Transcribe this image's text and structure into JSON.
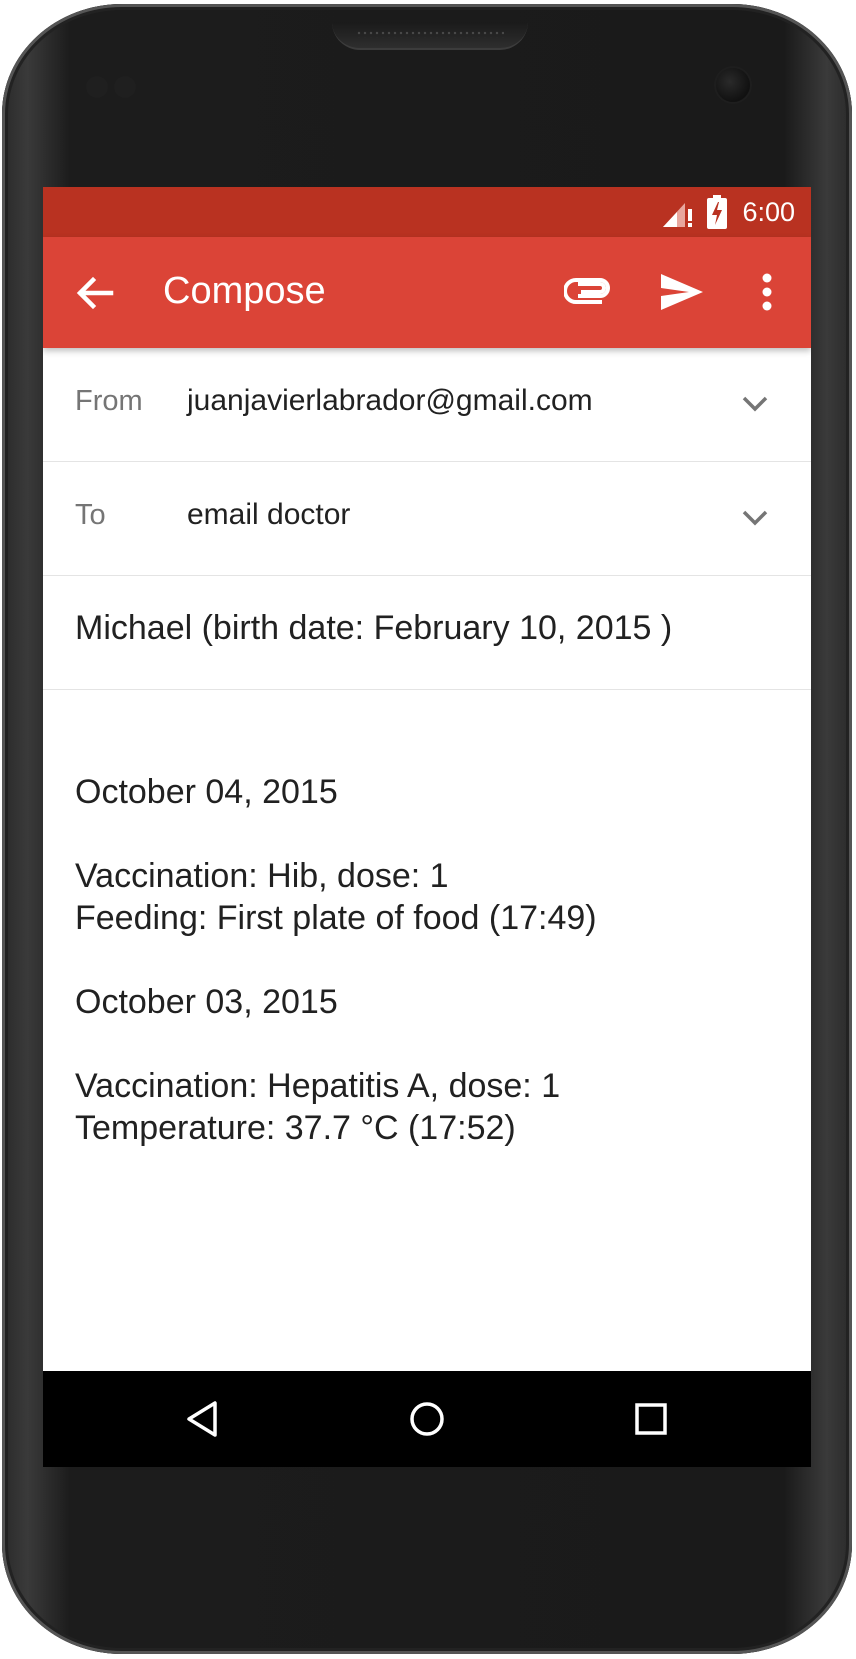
{
  "status_bar": {
    "time": "6:00"
  },
  "app_bar": {
    "title": "Compose",
    "icons": [
      "arrow-back-icon",
      "paperclip-icon",
      "send-icon",
      "more-vert-icon"
    ]
  },
  "from_row": {
    "label": "From",
    "value": "juanjavierlabrador@gmail.com"
  },
  "to_row": {
    "label": "To",
    "value": "email doctor"
  },
  "subject": "Michael (birth date: February 10, 2015 )",
  "body": {
    "lines": [
      "October 04, 2015",
      "",
      "Vaccination: Hib, dose: 1",
      "Feeding: First plate of food (17:49)",
      "",
      "October 03, 2015",
      "",
      "Vaccination: Hepatitis A, dose: 1",
      "Temperature: 37.7 °C (17:52)"
    ]
  },
  "nav_bar": {
    "icons": [
      "nav-back-icon",
      "nav-home-icon",
      "nav-recents-icon"
    ]
  },
  "colors": {
    "status_bar": "#b93221",
    "app_bar": "#db4437"
  }
}
